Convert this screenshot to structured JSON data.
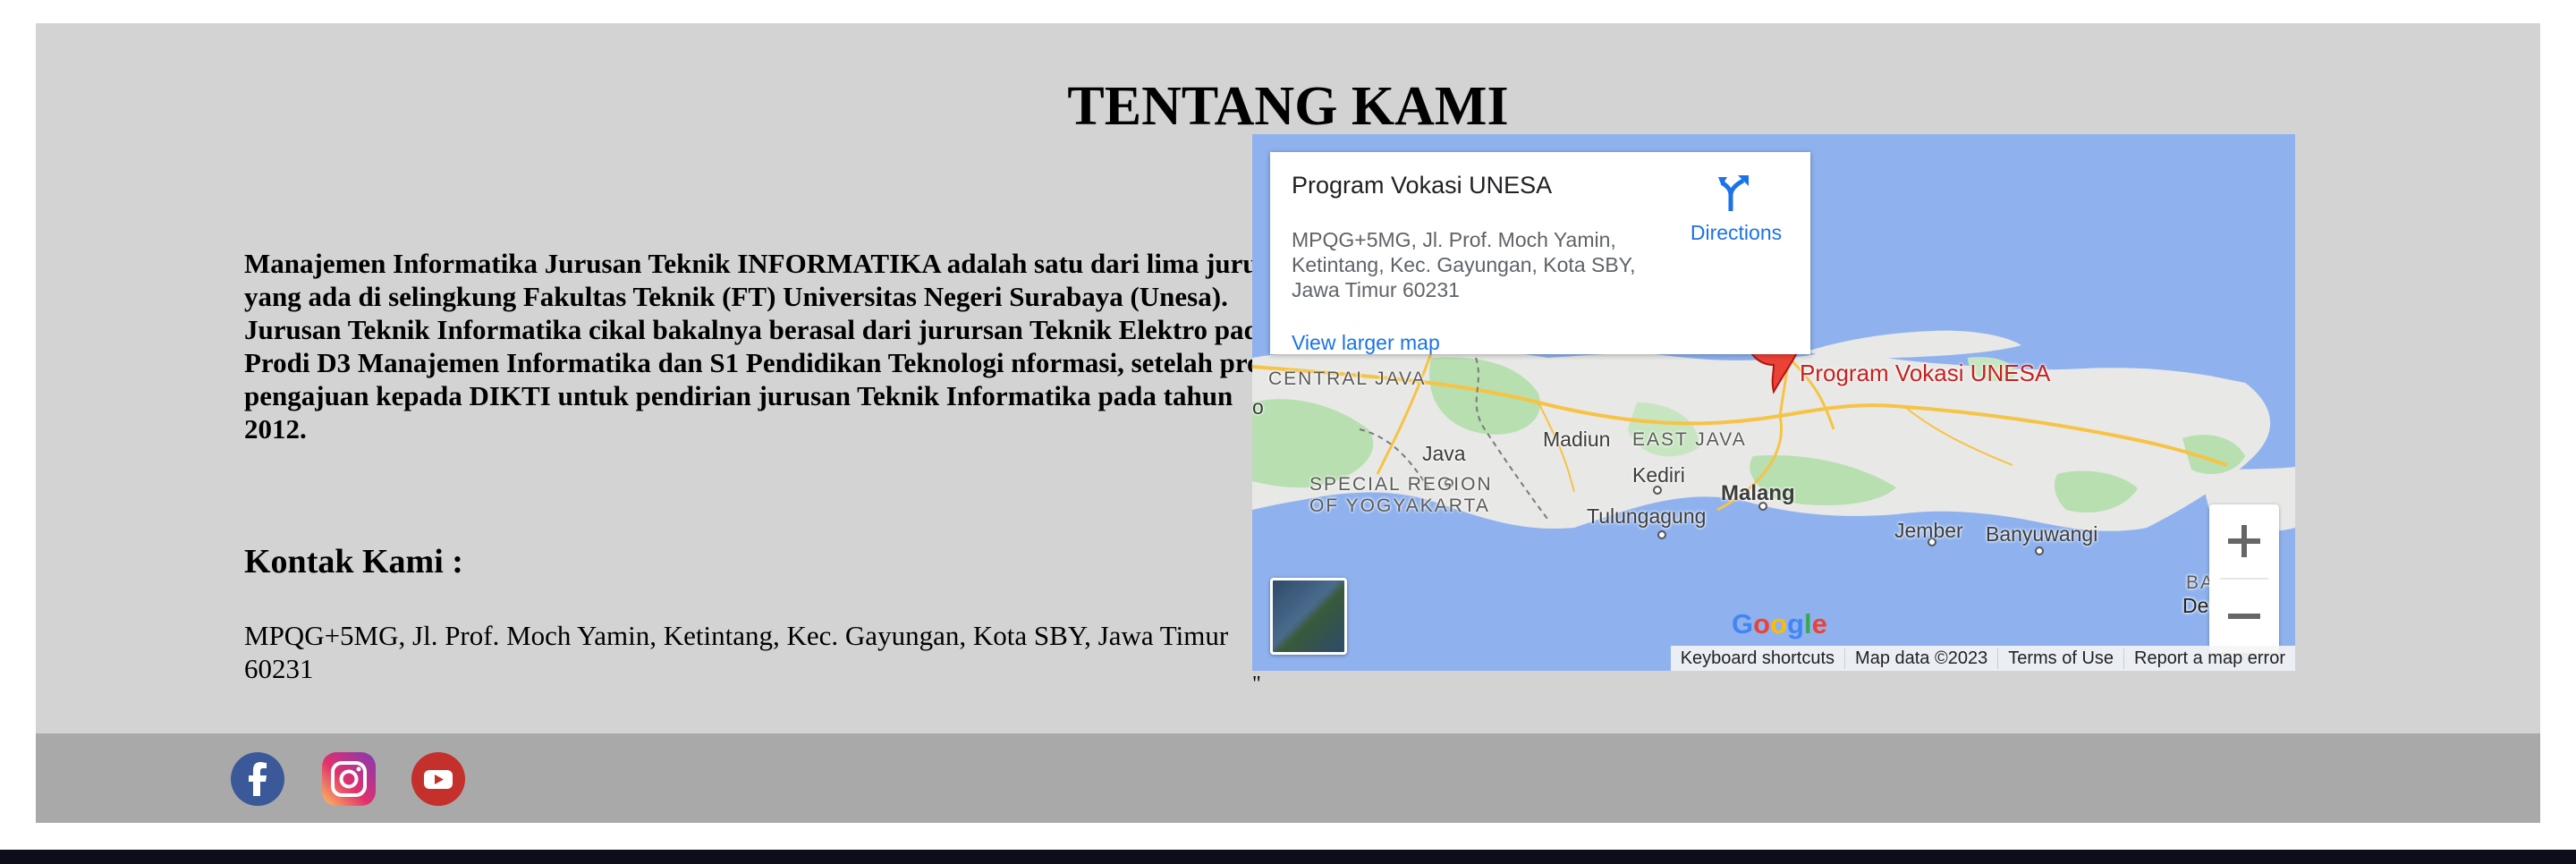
{
  "section": {
    "title": "TENTANG KAMI",
    "about": "Manajemen Informatika Jurusan Teknik INFORMATIKA adalah satu dari lima jurusan yang ada di selingkung Fakultas Teknik (FT) Universitas Negeri Surabaya (Unesa). Jurusan Teknik Informatika cikal bakalnya berasal dari jurursan Teknik Elektro pada Prodi D3 Manajemen Informatika dan S1 Pendidikan Teknologi nformasi, setelah proses pengajuan kepada DIKTI untuk pendirian jurusan Teknik Informatika pada tahun 2012.",
    "contact_heading": "Kontak Kami :",
    "contact_address": "MPQG+5MG, Jl. Prof. Moch Yamin, Ketintang, Kec. Gayungan, Kota SBY, Jawa Timur 60231",
    "stray_quote": "\""
  },
  "map": {
    "place_name": "Program Vokasi UNESA",
    "place_address": "MPQG+5MG, Jl. Prof. Moch Yamin, Ketintang, Kec. Gayungan, Kota SBY, Jawa Timur 60231",
    "directions_label": "Directions",
    "larger_map_label": "View larger map",
    "pin_label": "Program Vokasi UNESA",
    "labels": {
      "central_java": "CENTRAL JAVA",
      "east_java": "EAST JAVA",
      "madiun": "Madiun",
      "java": "Java",
      "kediri": "Kediri",
      "special_region": "SPECIAL REGION",
      "of_yogyakarta": "OF YOGYAKARTA",
      "tulungagung": "Tulungagung",
      "malang": "Malang",
      "jember": "Jember",
      "banyuwangi": "Banyuwangi",
      "bali": "BALI",
      "denpasar": "Denpas",
      "edge_o": "o"
    },
    "zoom_in": "+",
    "zoom_out": "−",
    "attribution": {
      "keyboard": "Keyboard shortcuts",
      "map_data": "Map data ©2023",
      "terms": "Terms of Use",
      "report": "Report a map error"
    },
    "colors": {
      "water": "#8fb2ef",
      "land": "#e8e8e6",
      "park": "#b7dfb0",
      "pin": "#ea4335",
      "link": "#1a73e8"
    }
  },
  "footer": {
    "icons": [
      "facebook-icon",
      "instagram-icon",
      "youtube-icon"
    ],
    "background": "#a9a9a9"
  }
}
